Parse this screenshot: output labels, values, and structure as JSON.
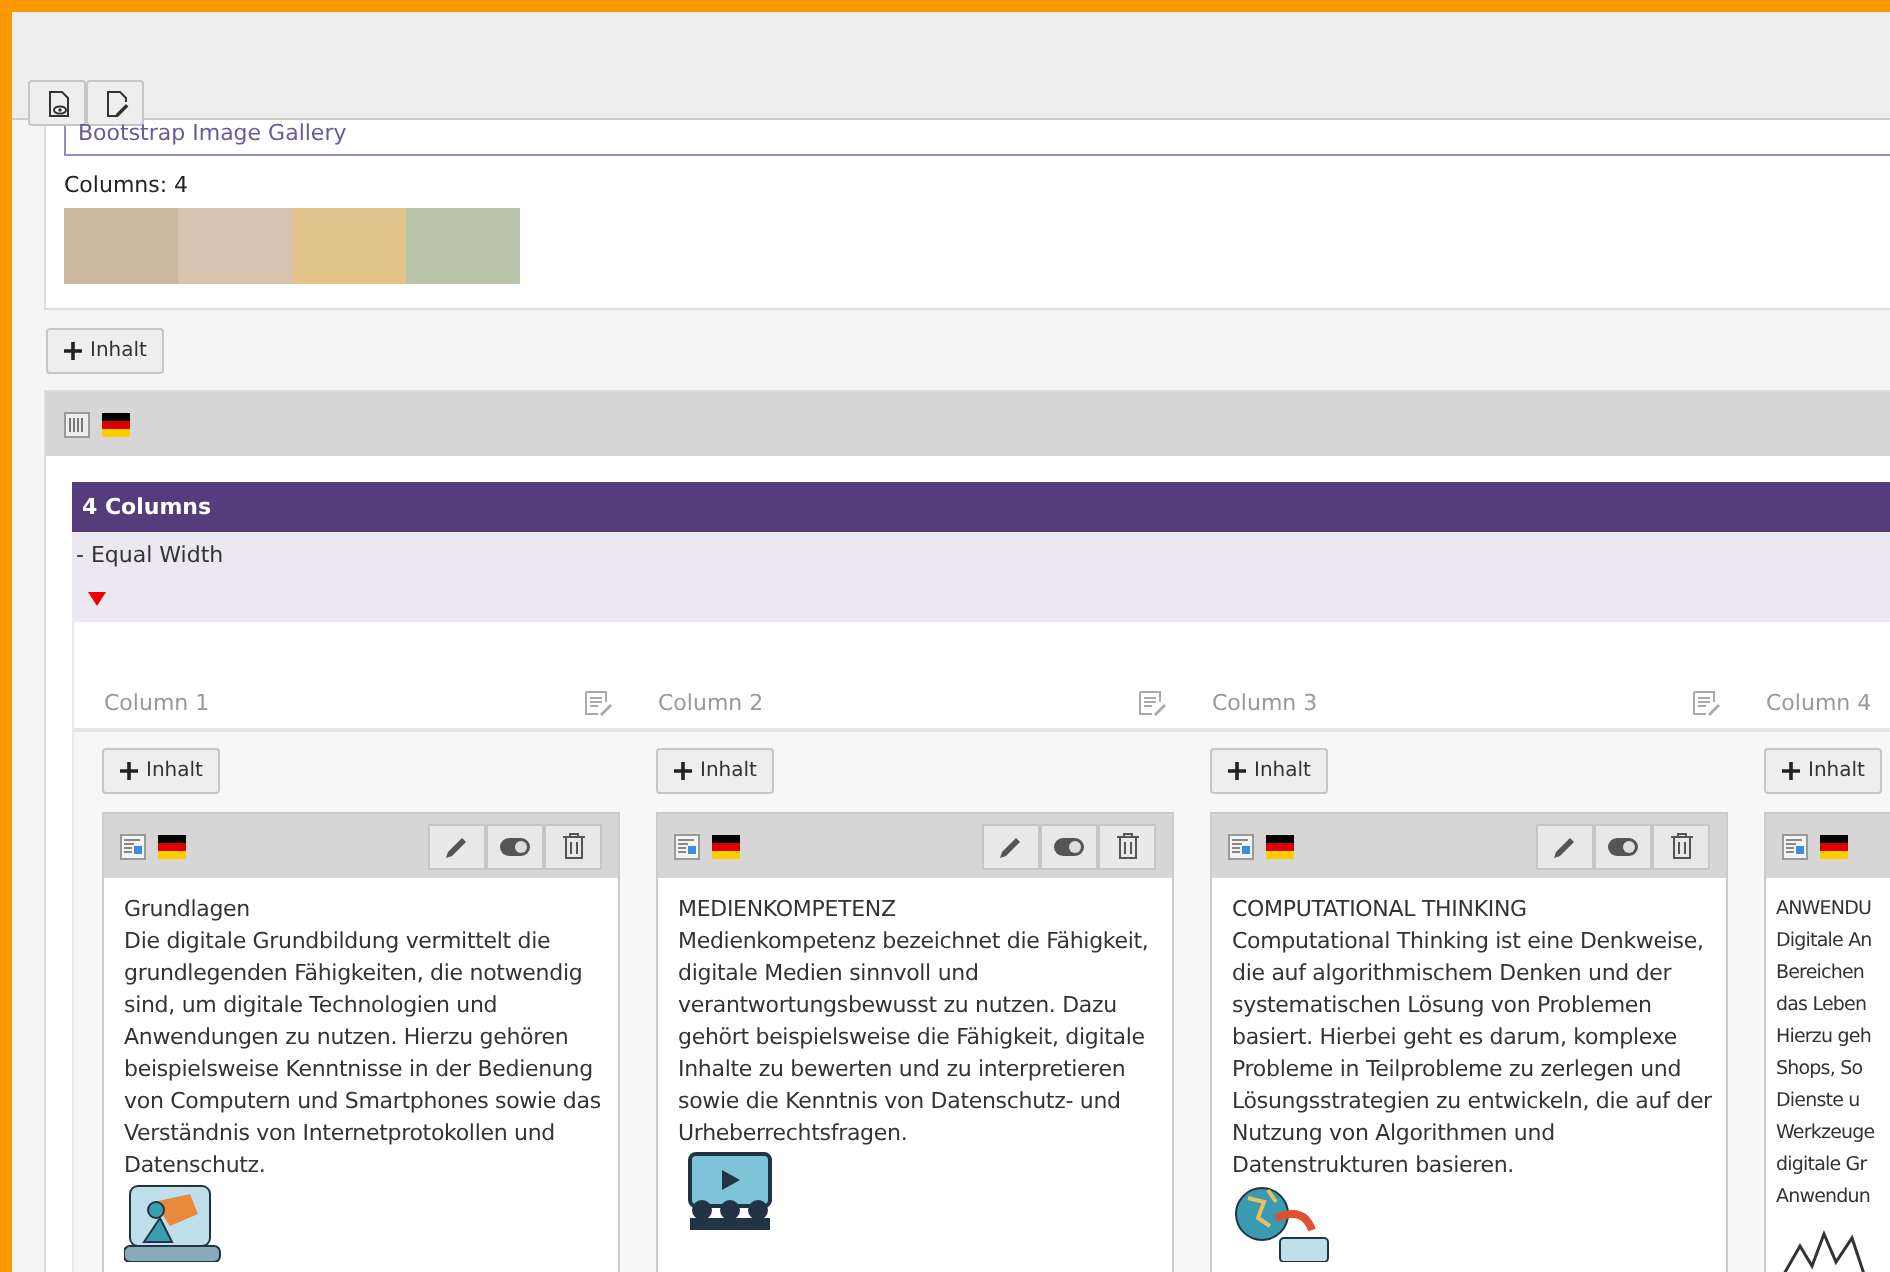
{
  "gallery": {
    "title": "Bootstrap Image Gallery",
    "columns_label": "Columns: 4"
  },
  "add_button": {
    "label": "Inhalt"
  },
  "grid": {
    "title": "4 Columns",
    "subtitle": "- Equal Width",
    "expanded": true
  },
  "columns": [
    {
      "heading": "Column 1",
      "add_label": "Inhalt",
      "card": {
        "title": "Grundlagen",
        "body": "Die digitale Grundbildung vermittelt die grundlegenden Fähigkeiten, die notwendig sind, um digitale Technologien und Anwendungen zu nutzen. Hierzu gehören beispielsweise Kenntnisse in der Bedienung von Computern und Smartphones sowie das Verständnis von Internetprotokollen und Datenschutz."
      }
    },
    {
      "heading": "Column 2",
      "add_label": "Inhalt",
      "card": {
        "title": "MEDIENKOMPETENZ",
        "body": "Medienkompetenz bezeichnet die Fähigkeit, digitale Medien sinnvoll und verantwortungsbewusst zu nutzen. Dazu gehört beispielsweise die Fähigkeit, digitale Inhalte zu bewerten und zu interpretieren sowie die Kenntnis von Datenschutz- und Urheberrechtsfragen."
      }
    },
    {
      "heading": "Column 3",
      "add_label": "Inhalt",
      "card": {
        "title": "COMPUTATIONAL THINKING",
        "body": "Computational Thinking ist eine Denkweise, die auf algorithmischem Denken und der systematischen Lösung von Problemen basiert. Hierbei geht es darum, komplexe Probleme in Teilprobleme zu zerlegen und Lösungsstrategien zu entwickeln, die auf der Nutzung von Algorithmen und Datenstrukturen basieren."
      }
    },
    {
      "heading": "Column 4",
      "add_label": "Inhalt",
      "card": {
        "title": "ANWENDU",
        "body_lines": [
          "Digitale An",
          "Bereichen",
          "das Leben",
          "Hierzu geh",
          "Shops, So",
          "Dienste u",
          "Werkzeuge",
          "digitale Gr",
          "Anwendun"
        ]
      }
    }
  ]
}
